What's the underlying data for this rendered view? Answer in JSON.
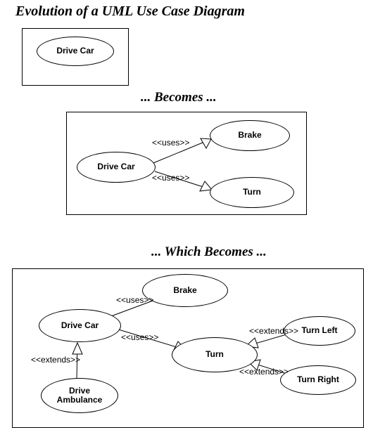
{
  "title": "Evolution of a UML Use Case Diagram",
  "transition1": "... Becomes ...",
  "transition2": "... Which Becomes ...",
  "rel_uses": "<<uses>>",
  "rel_extends": "<<extends>>",
  "stage1": {
    "usecases": {
      "drive_car": "Drive Car"
    }
  },
  "stage2": {
    "usecases": {
      "drive_car": "Drive Car",
      "brake": "Brake",
      "turn": "Turn"
    }
  },
  "stage3": {
    "usecases": {
      "drive_car": "Drive Car",
      "brake": "Brake",
      "turn": "Turn",
      "drive_ambulance": "Drive\nAmbulance",
      "turn_left": "Turn Left",
      "turn_right": "Turn Right"
    }
  }
}
